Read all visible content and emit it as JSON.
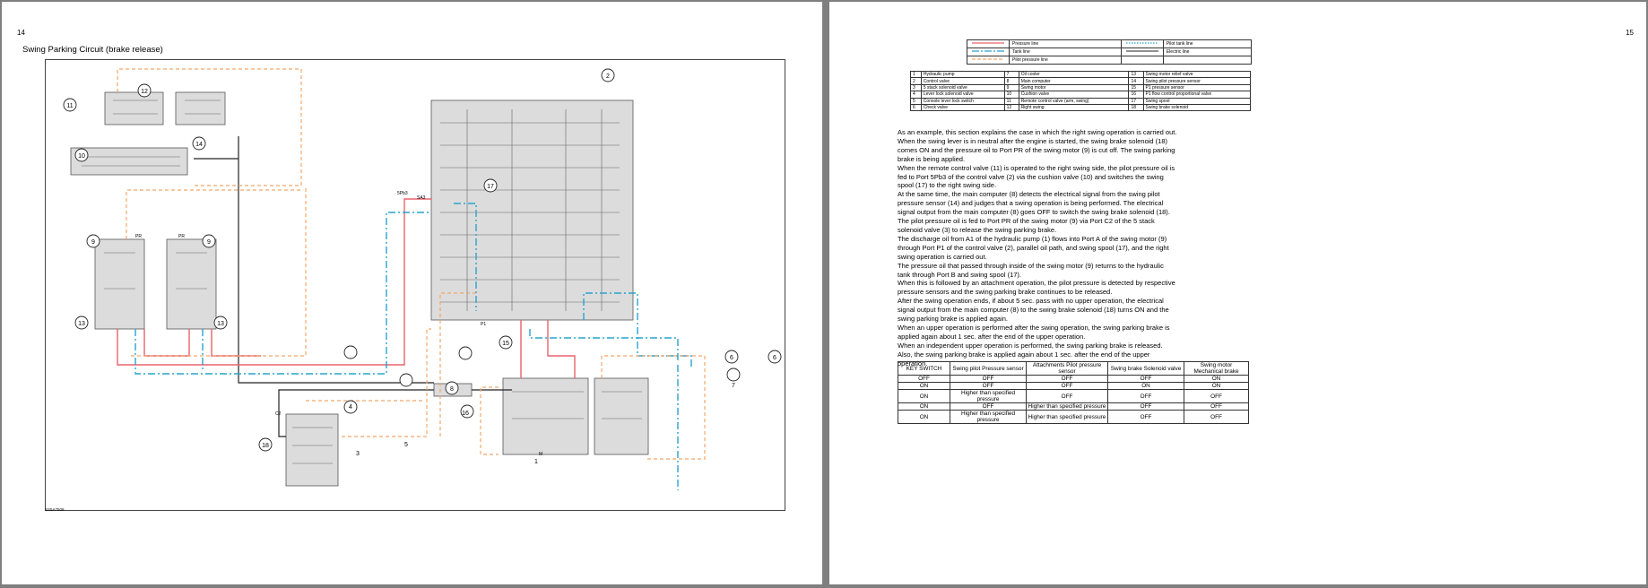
{
  "left_page": {
    "page_number": "14",
    "title": "Swing Parking Circuit (brake release)",
    "figure_code": "SS5A7508",
    "callouts": [
      "1",
      "2",
      "3",
      "4",
      "5",
      "6",
      "6",
      "7",
      "8",
      "9",
      "9",
      "10",
      "11",
      "12",
      "13",
      "13",
      "14",
      "15",
      "16",
      "17",
      "18"
    ],
    "port_labels": [
      "5Pb3",
      "SA3",
      "PR",
      "PR",
      "P1",
      "C2",
      "M"
    ]
  },
  "right_page": {
    "page_number": "15",
    "legend": [
      {
        "left": "Pressure line",
        "right": "Pilot tank line"
      },
      {
        "left": "Tank line",
        "right": "Electric line"
      },
      {
        "left": "Pilot pressure line",
        "right": ""
      }
    ],
    "parts": [
      [
        "1",
        "Hydraulic pump",
        "7",
        "Oil cooler",
        "13",
        "Swing motor relief valve"
      ],
      [
        "2",
        "Control valve",
        "8",
        "Main computer",
        "14",
        "Swing pilot pressure sensor"
      ],
      [
        "3",
        "5 stack solenoid valve",
        "9",
        "Swing motor",
        "15",
        "P1 pressure sensor"
      ],
      [
        "4",
        "Lever lock solenoid valve",
        "10",
        "Cushion valve",
        "16",
        "P1 flow control proportional valve"
      ],
      [
        "5",
        "Console lever lock switch",
        "11",
        "Remote control valve (arm, swing)",
        "17",
        "Swing spool"
      ],
      [
        "6",
        "Check valve",
        "12",
        "Right swing",
        "18",
        "Swing brake solenoid"
      ]
    ],
    "paragraphs": [
      "As an example, this section explains the case in which the right swing operation is carried out.",
      "When the swing lever is in neutral after the engine is started, the swing brake solenoid (18) comes ON and the pressure oil to Port PR of the swing motor (9) is cut off. The swing parking brake is being applied.",
      "When the remote control valve (11) is operated to the right swing side, the pilot pressure oil is fed to Port 5Pb3 of the control valve (2) via the cushion valve (10) and switches the swing spool (17) to the right swing side.",
      "At the same time, the main computer (8) detects the electrical signal from the swing pilot pressure sensor (14) and judges that a swing operation is being performed. The electrical signal output from the main computer (8) goes OFF to switch the swing brake solenoid (18).",
      "The pilot pressure oil is fed to Port PR of the swing motor (9) via Port C2 of the 5 stack solenoid valve (3) to release the swing parking brake.",
      "The discharge oil from A1 of the hydraulic pump (1) flows into Port A of the swing motor (9) through Port P1 of the control valve (2), parallel oil path, and swing spool (17), and the right swing operation is carried out.",
      "The pressure oil that passed through inside of the swing motor (9) returns to the hydraulic tank through Port B and swing spool (17).",
      "When this is followed by an attachment operation, the pilot pressure is detected by respective pressure sensors and the swing parking brake continues to be released.",
      "After the swing operation ends, if about 5 sec. pass with no upper operation, the electrical signal output from the main computer (8) to the swing brake solenoid (18) turns ON and the swing parking brake is applied again.",
      "When an upper operation is performed after the swing operation, the swing parking brake is applied again about 1 sec. after the end of the upper operation.",
      "When an independent upper operation is performed, the swing parking brake is released.",
      "Also, the swing parking brake is applied again about 1 sec. after the end of the upper operation."
    ],
    "state_table": {
      "headers": [
        "KEY SWITCH",
        "Swing pilot Pressure sensor",
        "Attachments Pilot pressure sensor",
        "Swing brake Solenoid valve",
        "Swing motor Mechanical brake"
      ],
      "rows": [
        [
          "OFF",
          "OFF",
          "OFF",
          "OFF",
          "ON"
        ],
        [
          "ON",
          "OFF",
          "OFF",
          "ON",
          "ON"
        ],
        [
          "ON",
          "Higher than specified pressure",
          "OFF",
          "OFF",
          "OFF"
        ],
        [
          "ON",
          "OFF",
          "Higher than specified pressure",
          "OFF",
          "OFF"
        ],
        [
          "ON",
          "Higher than specified pressure",
          "Higher than specified pressure",
          "OFF",
          "OFF"
        ]
      ]
    },
    "colors": {
      "pressure": "#e8636b",
      "tank": "#29a4cf",
      "pilot_pressure": "#f2a86a",
      "pilot_tank": "#29a4cf",
      "electric": "#222222",
      "component": "#dcdcdc"
    }
  }
}
